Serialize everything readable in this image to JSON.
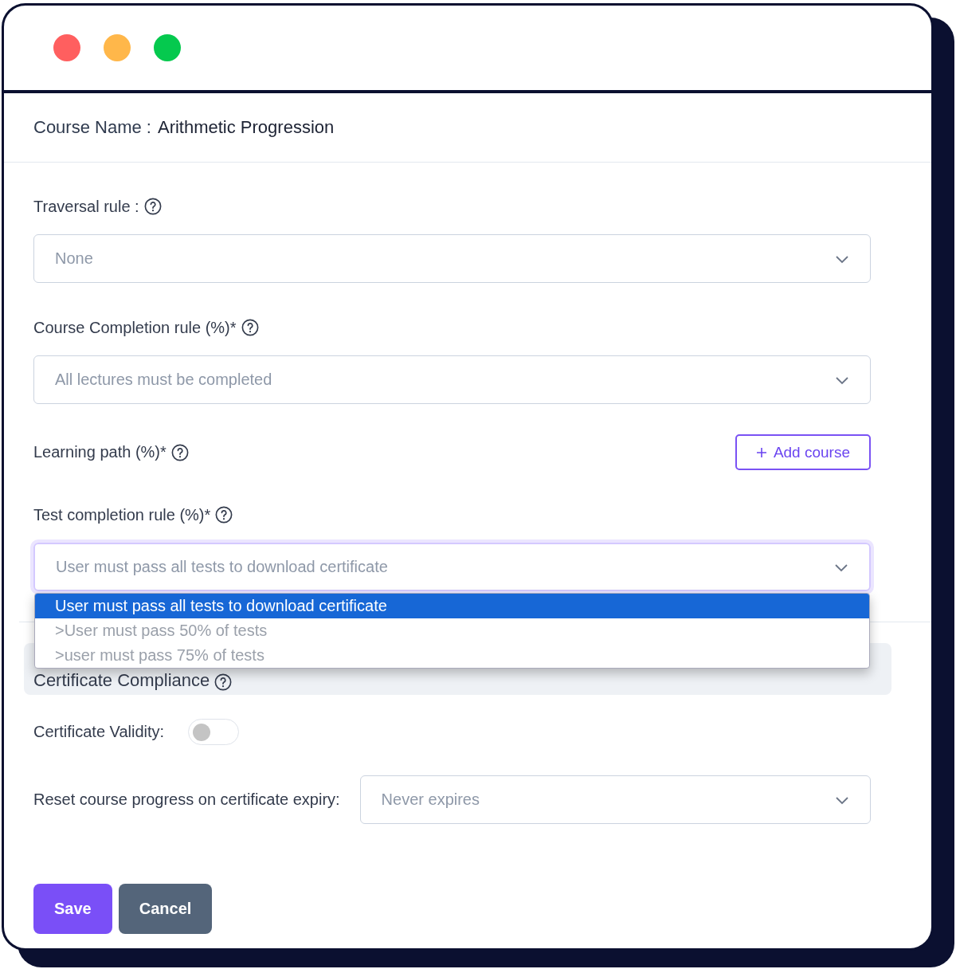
{
  "window": {
    "controls": [
      {
        "color": "#ff5f5f"
      },
      {
        "color": "#ffb74a"
      },
      {
        "color": "#05c94e"
      }
    ]
  },
  "course_name": {
    "label": "Course Name :",
    "value": "Arithmetic Progression"
  },
  "fields": [
    {
      "kind": "select",
      "label": "Traversal rule :",
      "placeholder": "None"
    },
    {
      "kind": "select",
      "label": "Course Completion rule (%)*",
      "placeholder": "All lectures must be completed"
    },
    {
      "kind": "action",
      "label": "Learning path (%)*",
      "button": "Add course"
    },
    {
      "kind": "select",
      "label": "Test completion rule (%)*",
      "placeholder": "User must pass all tests to download certificate",
      "focused": true,
      "expanded": true,
      "options": [
        {
          "label": "User must pass all tests to download certificate",
          "selected": true
        },
        {
          "label": ">User must pass 50% of tests",
          "selected": false
        },
        {
          "label": ">user must pass 75% of tests",
          "selected": false
        }
      ]
    }
  ],
  "certificate_section": {
    "title": "Certificate Compliance",
    "validity": {
      "label": "Certificate Validity:",
      "on": false
    },
    "reset": {
      "label": "Reset course progress on certificate expiry:",
      "placeholder": "Never expires"
    }
  },
  "buttons": [
    {
      "kind": "primary",
      "label": "Save"
    },
    {
      "kind": "secondary",
      "label": "Cancel"
    }
  ]
}
